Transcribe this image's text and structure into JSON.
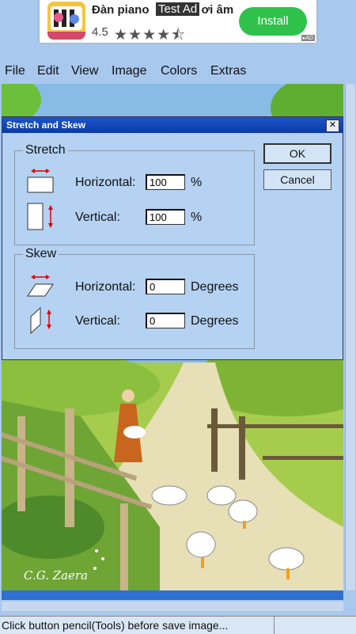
{
  "ad": {
    "title_prefix": "Đàn piano",
    "test_label": "Test Ad",
    "title_suffix": "ơi âm",
    "rating": "4.5",
    "stars": "★★★★⯪",
    "install_label": "Install",
    "ad_badge": "▸AD"
  },
  "menu": [
    "File",
    "Edit",
    "View",
    "Image",
    "Colors",
    "Extras"
  ],
  "dialog": {
    "title": "Stretch and Skew",
    "close_label": "✕",
    "stretch": {
      "group_label": "Stretch",
      "horizontal_label": "Horizontal:",
      "horizontal_value": "100",
      "horizontal_unit": "%",
      "vertical_label": "Vertical:",
      "vertical_value": "100",
      "vertical_unit": "%"
    },
    "skew": {
      "group_label": "Skew",
      "horizontal_label": "Horizontal:",
      "horizontal_value": "0",
      "horizontal_unit": "Degrees",
      "vertical_label": "Vertical:",
      "vertical_value": "0",
      "vertical_unit": "Degrees"
    },
    "ok_label": "OK",
    "cancel_label": "Cancel"
  },
  "painting": {
    "signature": "C.G. Zaera"
  },
  "status": {
    "message": "Click button pencil(Tools) before save image..."
  },
  "colors": {
    "titlebar": "#1c56c8",
    "dialog_bg": "#b5d2f2",
    "install_green": "#2fc24a",
    "arrow_red": "#e00000"
  }
}
